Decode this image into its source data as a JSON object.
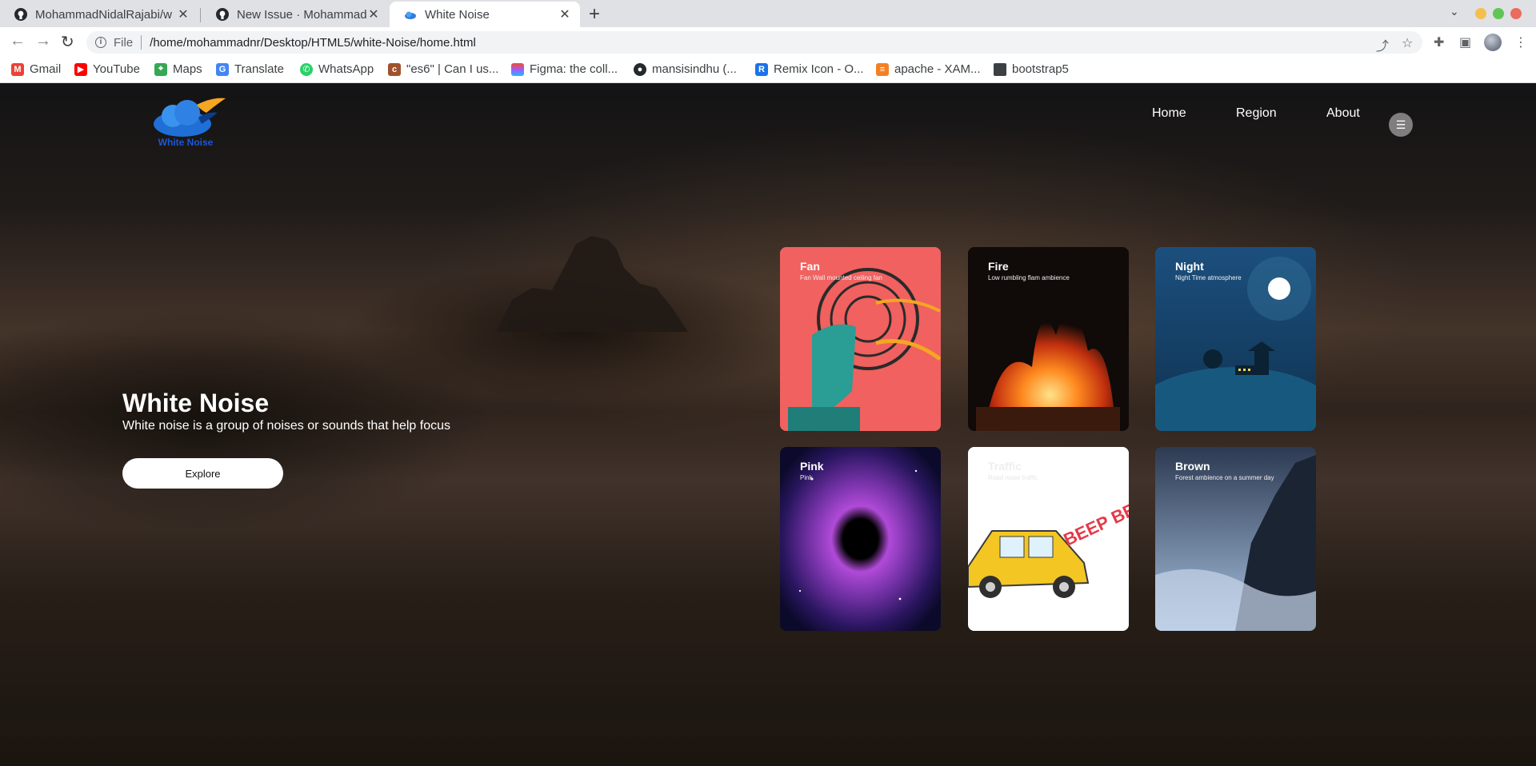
{
  "browser": {
    "tabs": [
      {
        "title": "MohammadNidalRajabi/w",
        "active": false
      },
      {
        "title": "New Issue · MohammadN",
        "active": false
      },
      {
        "title": "White Noise",
        "active": true
      }
    ],
    "address": {
      "scheme_label": "File",
      "url": "/home/mohammadnr/Desktop/HTML5/white-Noise/home.html"
    },
    "bookmarks": [
      {
        "label": "Gmail",
        "icon": "gmail-icon"
      },
      {
        "label": "YouTube",
        "icon": "youtube-icon"
      },
      {
        "label": "Maps",
        "icon": "maps-icon"
      },
      {
        "label": "Translate",
        "icon": "translate-icon"
      },
      {
        "label": "WhatsApp",
        "icon": "whatsapp-icon"
      },
      {
        "label": "\"es6\" | Can I us...",
        "icon": "caniuse-icon"
      },
      {
        "label": "Figma: the coll...",
        "icon": "figma-icon"
      },
      {
        "label": "mansisindhu (...",
        "icon": "github-icon"
      },
      {
        "label": "Remix Icon - O...",
        "icon": "remix-icon"
      },
      {
        "label": "apache - XAM...",
        "icon": "stackoverflow-icon"
      },
      {
        "label": "bootstrap5",
        "icon": "folder-icon"
      }
    ],
    "colors": {
      "tabbar": "#dfe1e5",
      "close": "#ed6a5e",
      "minimize": "#f5bf4f",
      "maximize": "#61c554"
    }
  },
  "site": {
    "logo_text": "White Noise",
    "nav": {
      "home": "Home",
      "region": "Region",
      "about": "About"
    },
    "hero": {
      "title": "White Noise",
      "subtitle": "White noise is a group of noises or sounds that help focus",
      "button": "Explore"
    },
    "cards": [
      {
        "title": "Fan",
        "desc": "Fan Wall mounted ceiling fan"
      },
      {
        "title": "Fire",
        "desc": "Low rumbling flam ambience"
      },
      {
        "title": "Night",
        "desc": "Night Time atmosphere"
      },
      {
        "title": "Pink",
        "desc": "Pink"
      },
      {
        "title": "Traffic",
        "desc": "Road noise traffic"
      },
      {
        "title": "Brown",
        "desc": "Forest ambience on a summer day"
      }
    ],
    "colors": {
      "logo_text": "#1b57d6",
      "explore_bg": "#ffffff"
    }
  }
}
